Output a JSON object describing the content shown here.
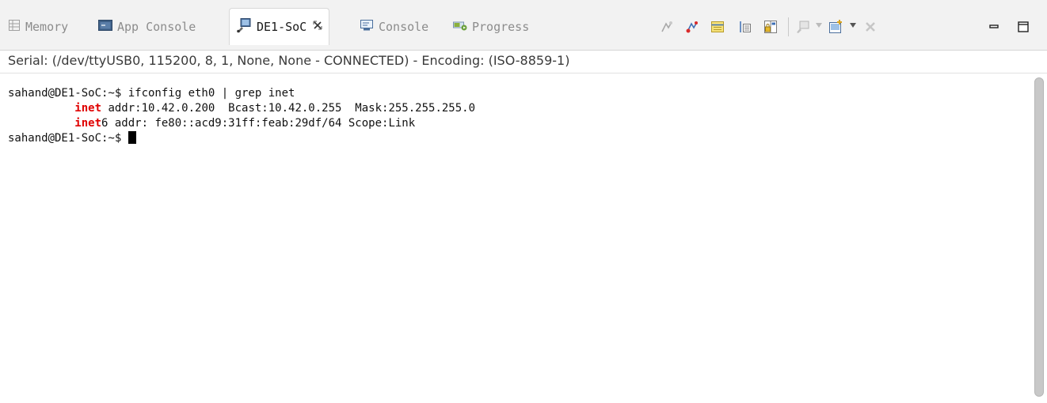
{
  "tabs": [
    {
      "label": "Memory",
      "icon": "memory-icon",
      "active": false
    },
    {
      "label": "App Console",
      "icon": "app-console-icon",
      "active": false
    },
    {
      "label": "DE1-SoC",
      "icon": "serial-terminal-icon",
      "active": true,
      "close_glyph": "✕"
    },
    {
      "label": "Console",
      "icon": "console-icon",
      "active": false
    },
    {
      "label": "Progress",
      "icon": "progress-icon",
      "active": false
    }
  ],
  "toolbar": {
    "buttons": [
      "connect-icon",
      "disconnect-icon",
      "settings-icon",
      "scroll-lock-icon",
      "lock-icon",
      "display-selected-icon",
      "new-terminal-icon",
      "remove-icon",
      "minimize-icon",
      "maximize-icon"
    ]
  },
  "status": {
    "text": "Serial: (/dev/ttyUSB0, 115200, 8, 1, None, None - CONNECTED) - Encoding: (ISO-8859-1)"
  },
  "terminal": {
    "line1": "sahand@DE1-SoC:~$ ifconfig eth0 | grep inet",
    "line2_indent": "          ",
    "line2_keyword": "inet",
    "line2_rest": " addr:10.42.0.200  Bcast:10.42.0.255  Mask:255.255.255.0",
    "line3_indent": "          ",
    "line3_keyword": "inet",
    "line3_rest": "6 addr: fe80::acd9:31ff:feab:29df/64 Scope:Link",
    "line4": "sahand@DE1-SoC:~$ "
  },
  "colors": {
    "highlight": "#e00000",
    "tabbar_bg": "#f2f2f2",
    "inactive_tab_text": "#8c8c8c"
  }
}
